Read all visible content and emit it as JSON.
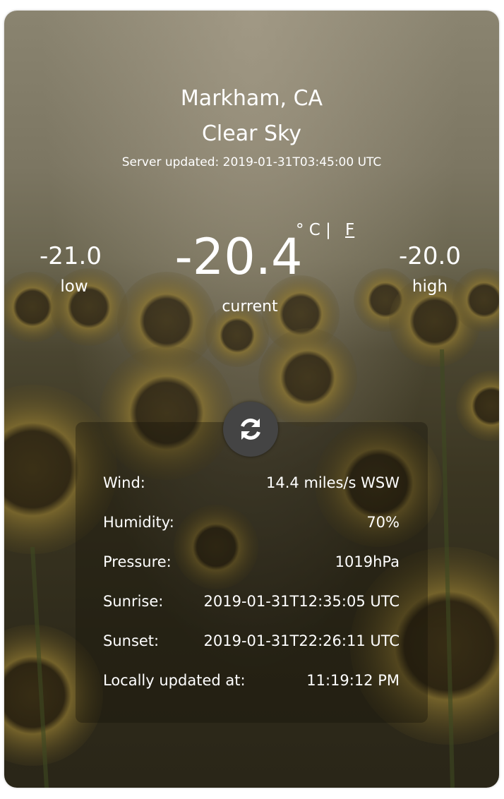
{
  "location": {
    "city": "Markham, CA",
    "condition": "Clear Sky",
    "server_updated": "Server updated: 2019-01-31T03:45:00 UTC"
  },
  "temperature": {
    "low_value": "-21.0",
    "low_label": "low",
    "current_value": "-20.4",
    "current_label": "current",
    "high_value": "-20.0",
    "high_label": "high",
    "unit_celsius": "° C |",
    "unit_fahrenheit": "F"
  },
  "details": {
    "rows": [
      {
        "label": "Wind:",
        "value": "14.4 miles/s WSW"
      },
      {
        "label": "Humidity:",
        "value": "70%"
      },
      {
        "label": "Pressure:",
        "value": "1019hPa"
      },
      {
        "label": "Sunrise:",
        "value": "2019-01-31T12:35:05 UTC"
      },
      {
        "label": "Sunset:",
        "value": "2019-01-31T22:26:11 UTC"
      },
      {
        "label": "Locally updated at:",
        "value": "11:19:12 PM"
      }
    ]
  },
  "icons": {
    "refresh": "refresh-icon"
  },
  "colors": {
    "text": "#ffffff",
    "refresh_button": "#444444"
  }
}
